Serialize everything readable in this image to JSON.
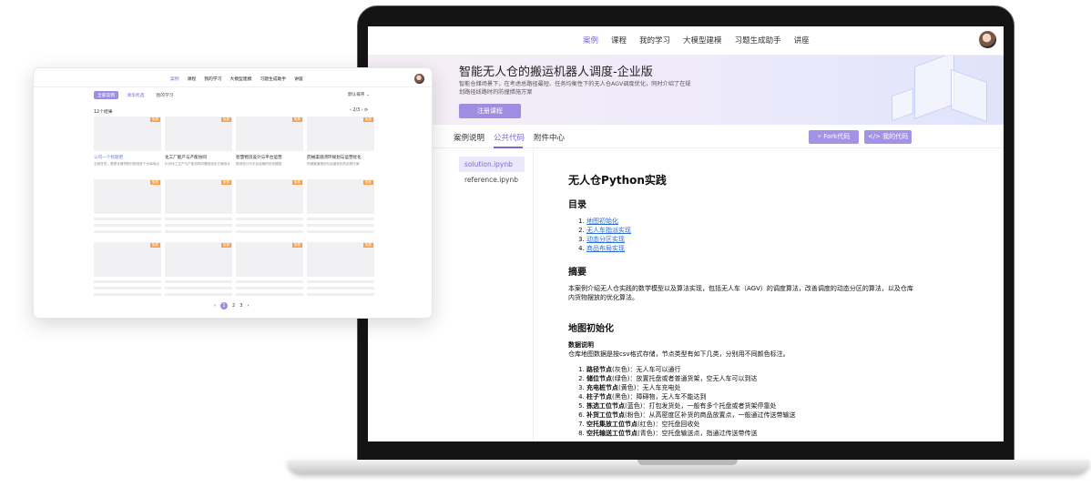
{
  "nav": {
    "items": [
      "案例",
      "课程",
      "我的学习",
      "大模型建模",
      "习题生成助手",
      "讲座"
    ],
    "active_index": 0
  },
  "banner": {
    "title": "智能无人仓的搬运机器人调度-企业版",
    "description": "智能仓储场景下，在考虑总路径最短、任务均衡性下的无人仓AGV调度优化，同时介绍了在规划路径线路时的防撞措施方案",
    "register_label": "注册课程"
  },
  "tabs": {
    "case_desc": "案例说明",
    "public_code": "公共代码",
    "attachments": "附件中心",
    "fork_label": "Fork代码",
    "my_code_label": "我的代码"
  },
  "files": [
    "solution.ipynb",
    "reference.ipynb"
  ],
  "doc": {
    "title": "无人仓Python实践",
    "toc_heading": "目录",
    "toc": [
      "地图初始化",
      "无人车指派实现",
      "动态分区实现",
      "商品布局实现"
    ],
    "summary_heading": "摘要",
    "summary": "本案例介绍无人仓实践的数学模型以及算法实现，包括无人车（AGV）的调度算法，改善调度的动态分区的算法，以及仓库内货物摆放的优化算法。",
    "map_heading": "地图初始化",
    "data_desc": "数据说明",
    "data_text": "仓库地图数据是按csv格式存储，节点类型有如下几类，分别用不同颜色标注。",
    "nodes": [
      {
        "name": "路径节点",
        "desc": "(灰色)：无人车可以通行"
      },
      {
        "name": "储位节点",
        "desc": "(绿色)：放置托盘或者普通货架，空无人车可以到达"
      },
      {
        "name": "充电桩节点",
        "desc": "(黄色)：无人车充电处"
      },
      {
        "name": "柱子节点",
        "desc": "(黑色)：障碍物，无人车不能达到"
      },
      {
        "name": "拣选工位节点",
        "desc": "(蓝色)：打包发货处，一般有多个托盘或者货架停靠处"
      },
      {
        "name": "补货工位节点",
        "desc": "(粉色)：从高密度区补货的商品放置点，一般通过传送带输送"
      },
      {
        "name": "空托集放工位节点",
        "desc": "(红色)：空托盘回收处"
      },
      {
        "name": "空托输送工位节点",
        "desc": "(青色)：空托盘输送点，指通过传送带传送"
      }
    ]
  },
  "mini": {
    "nav": [
      "案例",
      "课程",
      "我的学习",
      "大模型建模",
      "习题生成助手",
      "讲座"
    ],
    "tabs": [
      "全部案例",
      "清华优选",
      "我的学习"
    ],
    "sort": "默认排序",
    "count": "12个结果",
    "pager_top": "2/3",
    "cards": [
      {
        "tag": "免费",
        "title": "公司一个标题吧",
        "desc": "当前任务，是把仓储货物分配到多个仓库地点",
        "blue": true
      },
      {
        "tag": "免费",
        "title": "化工厂能产与产能协同",
        "desc": "针对化工生产与产能协同问题的优化方案设计",
        "blue": false
      },
      {
        "tag": "免费",
        "title": "智慧物流设计与平台运营",
        "desc": "物流设计与平台运营的优化模型",
        "blue": false
      },
      {
        "tag": "免费",
        "title": "药械渠道闭环规划与运营优化",
        "desc": "药械渠道规划与运营优化的实践方案",
        "blue": false
      }
    ],
    "placeholder_tag": "免费",
    "pages": [
      "1",
      "2",
      "3"
    ]
  }
}
